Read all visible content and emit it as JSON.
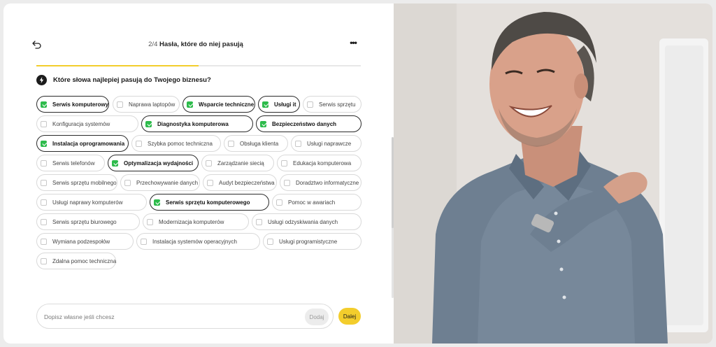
{
  "header": {
    "step": "2/4",
    "title": "Hasła, które do niej pasują",
    "back_icon": "back-arrow-icon",
    "more_label": "•••"
  },
  "progress": {
    "value": 0.5,
    "fill_color": "#f3cd2c"
  },
  "question": {
    "icon": "lightning-bolt-icon",
    "text": "Które słowa najlepiej pasują do Twojego biznesu?"
  },
  "keywords": [
    {
      "label": "Serwis komputerowy",
      "selected": true
    },
    {
      "label": "Naprawa laptopów",
      "selected": false
    },
    {
      "label": "Wsparcie techniczne",
      "selected": true
    },
    {
      "label": "Usługi it",
      "selected": true
    },
    {
      "label": "Serwis sprzętu",
      "selected": false
    },
    {
      "label": "Konfiguracja systemów",
      "selected": false
    },
    {
      "label": "Diagnostyka komputerowa",
      "selected": true
    },
    {
      "label": "Bezpieczeństwo danych",
      "selected": true
    },
    {
      "label": "Instalacja oprogramowania",
      "selected": true
    },
    {
      "label": "Szybka pomoc techniczna",
      "selected": false
    },
    {
      "label": "Obsługa klienta",
      "selected": false
    },
    {
      "label": "Usługi naprawcze",
      "selected": false
    },
    {
      "label": "Serwis telefonów",
      "selected": false
    },
    {
      "label": "Optymalizacja wydajności",
      "selected": true
    },
    {
      "label": "Zarządzanie siecią",
      "selected": false
    },
    {
      "label": "Edukacja komputerowa",
      "selected": false
    },
    {
      "label": "Serwis sprzętu mobilnego",
      "selected": false
    },
    {
      "label": "Przechowywanie danych",
      "selected": false
    },
    {
      "label": "Audyt bezpieczeństwa",
      "selected": false
    },
    {
      "label": "Doradztwo informatyczne",
      "selected": false
    },
    {
      "label": "Usługi naprawy komputerów",
      "selected": false
    },
    {
      "label": "Serwis sprzętu komputerowego",
      "selected": true
    },
    {
      "label": "Pomoc w awariach",
      "selected": false
    },
    {
      "label": "Serwis sprzętu biurowego",
      "selected": false
    },
    {
      "label": "Modernizacja komputerów",
      "selected": false
    },
    {
      "label": "Usługi odzyskiwania danych",
      "selected": false
    },
    {
      "label": "Wymiana podzespołów",
      "selected": false
    },
    {
      "label": "Instalacja systemów operacyjnych",
      "selected": false
    },
    {
      "label": "Usługi programistyczne",
      "selected": false
    },
    {
      "label": "Zdalna pomoc techniczna",
      "selected": false
    }
  ],
  "custom_input": {
    "placeholder": "Dopisz własne jeśli chcesz",
    "value": "",
    "add_label": "Dodaj"
  },
  "next_label": "Dalej",
  "colors": {
    "accent": "#f3cd2c",
    "check": "#2dbb4b"
  }
}
